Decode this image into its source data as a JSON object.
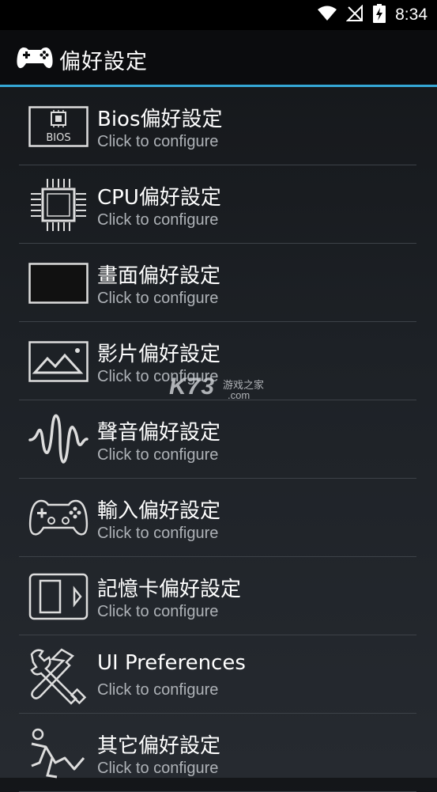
{
  "status_bar": {
    "time": "8:34",
    "icons": [
      "wifi-icon",
      "no-signal-icon",
      "battery-charging-icon"
    ]
  },
  "app_bar": {
    "title": "偏好設定",
    "icon": "gamepad-icon",
    "accent_color": "#35a7d5"
  },
  "items": [
    {
      "label": "Bios偏好設定",
      "sublabel": "Click to configure",
      "icon": "bios-chip-icon",
      "icon_text": "BIOS"
    },
    {
      "label": "CPU偏好設定",
      "sublabel": "Click to configure",
      "icon": "cpu-icon"
    },
    {
      "label": "畫面偏好設定",
      "sublabel": "Click to configure",
      "icon": "display-icon"
    },
    {
      "label": "影片偏好設定",
      "sublabel": "Click to configure",
      "icon": "image-icon"
    },
    {
      "label": "聲音偏好設定",
      "sublabel": "Click to configure",
      "icon": "sound-wave-icon"
    },
    {
      "label": "輸入偏好設定",
      "sublabel": "Click to configure",
      "icon": "controller-icon"
    },
    {
      "label": "記憶卡偏好設定",
      "sublabel": "Click to configure",
      "icon": "memory-card-icon"
    },
    {
      "label": "UI Preferences",
      "sublabel": "Click to configure",
      "icon": "tools-icon"
    },
    {
      "label": "其它偏好設定",
      "sublabel": "Click to configure",
      "icon": "running-person-icon"
    }
  ],
  "watermark": {
    "brand": "K73",
    "tagline": "游戏之家",
    "domain": ".com"
  }
}
